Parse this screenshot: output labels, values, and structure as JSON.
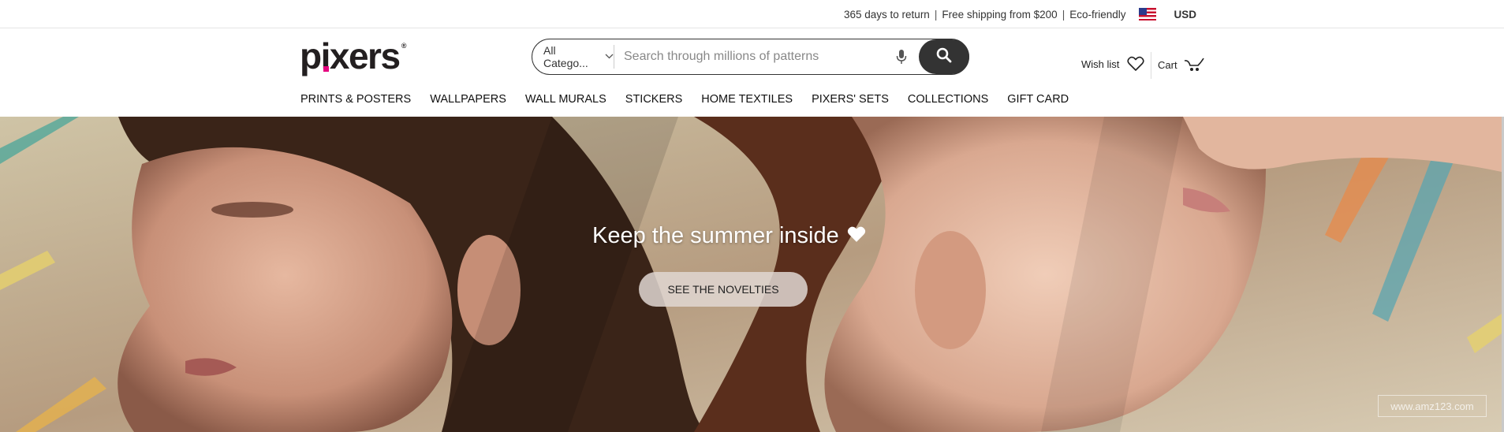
{
  "topbar": {
    "returns": "365 days to return",
    "shipping": "Free shipping from $200",
    "eco": "Eco-friendly",
    "separator": "|",
    "currency": "USD",
    "flag_icon": "us-flag-icon"
  },
  "header": {
    "logo_text": "pixers",
    "logo_reg": "®",
    "search": {
      "category_label": "All Catego...",
      "placeholder": "Search through millions of patterns",
      "value": ""
    },
    "wishlist_label": "Wish list",
    "cart_label": "Cart"
  },
  "nav": {
    "items": [
      "PRINTS & POSTERS",
      "WALLPAPERS",
      "WALL MURALS",
      "STICKERS",
      "HOME TEXTILES",
      "PIXERS' SETS",
      "COLLECTIONS",
      "GIFT CARD"
    ]
  },
  "hero": {
    "title": "Keep the summer inside",
    "cta": "SEE THE NOVELTIES",
    "watermark": "www.amz123.com"
  },
  "colors": {
    "brand_dot": "#e5007e",
    "search_button": "#333333"
  }
}
